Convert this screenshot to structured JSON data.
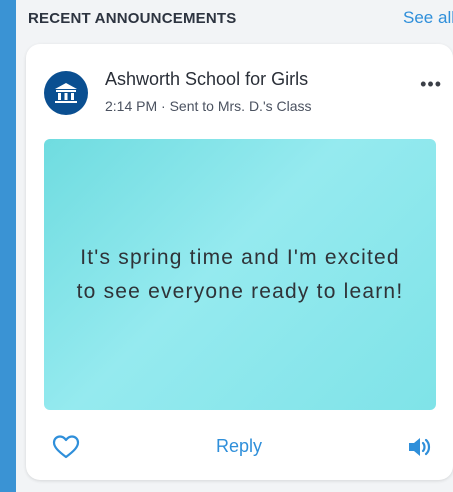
{
  "header": {
    "title": "RECENT ANNOUNCEMENTS",
    "see_all": "See all"
  },
  "post": {
    "avatar_icon": "school-building-icon",
    "school": "Ashworth School for Girls",
    "meta": "2:14 PM · Sent to Mrs. D.'s Class",
    "more_icon": "more-options-icon",
    "more_label": "•••",
    "image_text": "It's spring time and I'm excited to see everyone ready to learn!",
    "reply": "Reply",
    "like_icon": "heart-icon",
    "audio_icon": "speaker-icon"
  },
  "colors": {
    "accent": "#2f8fda",
    "avatar": "#0a4f91",
    "image_bg": "#8ee8ec",
    "left_strip": "#3a93d4"
  }
}
